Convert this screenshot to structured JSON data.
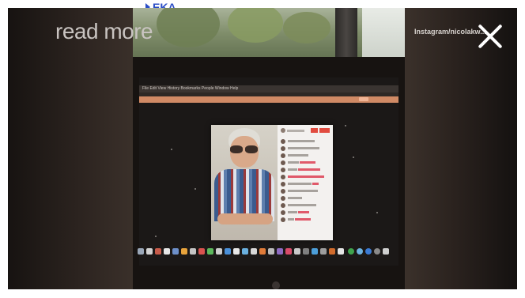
{
  "overlay": {
    "read_more": "read more",
    "top_link": "EKA",
    "instagram_handle": "Instagram/nicolakw..."
  },
  "laptop_screen": {
    "menu_items": "File  Edit  View  History  Bookmarks  People  Window  Help"
  },
  "colors": {
    "close_icon": "#ffffff",
    "read_more_text": "#c9c4c1",
    "link_blue": "#2b4ec7",
    "live_red": "#e14b3f",
    "browser_bar": "#d08a65"
  }
}
